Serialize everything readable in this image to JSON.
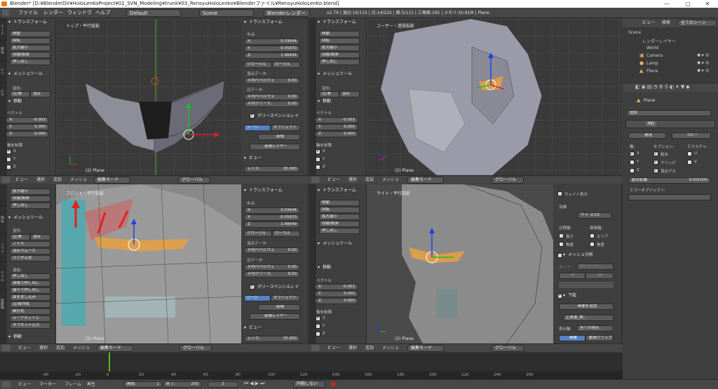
{
  "window": {
    "title": "Blender* [D:¥BlenderDir¥HoloLenKoProject¥01_SVN_Modeling¥trunk¥03_RensyuHoloLenko¥Blenderファイル¥RensyuHoloLenKo.blend]",
    "controls": [
      "—",
      "▢",
      "✕"
    ]
  },
  "infobar": {
    "menus": [
      "ファイル",
      "レンダー",
      "ウィンドウ",
      "ヘルプ"
    ],
    "screen_layout": "Default",
    "scene": "Scene",
    "render_engine": "Blenderレンダー",
    "stats": "v2.79 | 頂点:10/115 | 辺:14/225 | 面:5/111 | 三角面:195 | メモリ:30.91M | Plane"
  },
  "views": {
    "top_left": {
      "label": "トップ・平行投影",
      "object": "(2) Plane"
    },
    "top_right": {
      "label": "ユーザー・透視投影",
      "object": "(2) Plane"
    },
    "bottom_left": {
      "label": "フロント・平行投影",
      "object": "(2) Plane"
    },
    "bottom_right": {
      "label": "ライト・平行投影",
      "object": "(2) Plane"
    }
  },
  "view_header": {
    "menus": [
      "ビュー",
      "選択",
      "追加",
      "メッシュ"
    ],
    "mode": "編集モード",
    "orientation": "グローバル"
  },
  "tool_shelf": {
    "transform_title": "トランスフォーム",
    "transform_buttons": [
      "移動",
      "回転",
      "拡大縮小",
      "収縮/膨張",
      "押し出し"
    ],
    "mesh_tools_title": "メッシュツール",
    "deform_label": "変形:",
    "smooth_vertex": "辺/滑",
    "slide_vertex": "頂点",
    "noise": "ノイズ",
    "vertex_smooth": "頂点スムーズ",
    "randomize": "ランダム化",
    "add_label": "追加:",
    "extrude": "押し出し",
    "extrude_individual": "領域で押し出し",
    "extrude_along": "個々で押し出し",
    "duplicate": "面を差し込み",
    "edge_loop": "辺/面作成",
    "subdivide": "細分化",
    "loop_cut": "ループカットと",
    "offset_edge": "オフセット辺ス",
    "move_title": "移動",
    "vector_label": "ベクトル",
    "axis_constraint_label": "軸を制限",
    "vector": [
      {
        "axis": "X:",
        "value": "-0.003"
      },
      {
        "axis": "Y:",
        "value": "0.000"
      },
      {
        "axis": "Z:",
        "value": "0.000"
      }
    ],
    "axes": [
      "X",
      "Y",
      "Z"
    ]
  },
  "nprop": {
    "transform_title": "トランスフォーム",
    "median_label": "中点:",
    "median": [
      {
        "axis": "X:",
        "value": "0.03644"
      },
      {
        "axis": "Y:",
        "value": "-0.05870"
      },
      {
        "axis": "Z:",
        "value": "1.48449"
      }
    ],
    "global": "グローバル",
    "local": "ローカル",
    "vertex_data_label": "頂点データ:",
    "mean_bevel_weight": "平均ベベルウェ",
    "edge_data_label": "辺データ:",
    "mean_bevel_edge": "平均ベベルウェ",
    "mean_crease": "平均クリース:",
    "zero": "0.00",
    "gpencil_title": "グリースペンシルレイ",
    "scene": "シーン",
    "object": "オブジェクト",
    "new": "新規",
    "new_layer": "新規レイヤー",
    "view_title": "ビュー",
    "lens_label": "レンズ:",
    "lens_value": "35.000"
  },
  "outliner": {
    "menus": [
      "ビュー",
      "検索"
    ],
    "filter": "全てのシーン",
    "items": [
      {
        "name": "Scene",
        "color": "#cfcfcf"
      },
      {
        "name": "レンダーレイヤー",
        "color": "#cfcfcf"
      },
      {
        "name": "World",
        "color": "#cfcfcf"
      },
      {
        "name": "Camera",
        "color": "#e8b060"
      },
      {
        "name": "Lamp",
        "color": "#e8b060"
      },
      {
        "name": "Plane",
        "color": "#e8b060"
      }
    ]
  },
  "properties": {
    "object_name": "Plane",
    "add_modifier": "追加",
    "modifier_name": "Mir",
    "apply": "適用",
    "copy": "コピー",
    "axis_label": "軸:",
    "options_label": "オプション:",
    "texture_label": "テクスチャ:",
    "axes": [
      "X",
      "Y",
      "Z"
    ],
    "options": [
      "結合",
      "クリッピ",
      "頂点グル"
    ],
    "uv": [
      "U",
      "V"
    ],
    "merge_limit_label": "結合距離:",
    "merge_limit": "0.001000",
    "mirror_object_label": "ミラーオブジェクト:",
    "weight_display": "ウェイト表示",
    "normals_label": "法線",
    "size_label": "サイ: 0.10",
    "edge_info_label": "辺情報:",
    "face_info_label": "面情報:",
    "length": "長さ",
    "area": "エリア",
    "angle": "角度",
    "angle2": "角度",
    "mesh_analysis": "メッシュ分析",
    "type_label": "タイプ",
    "overhang": "オーバーハ...",
    "range_0": "0°",
    "range_45": "45°",
    "background_title": "下絵",
    "add_image": "画像を追加",
    "front_image": "正面進_横...",
    "axis_label2": "表示軸",
    "all_views": "全ての視点",
    "image": "画像",
    "movie_clip": "動画クリップ"
  },
  "timeline": {
    "menus": [
      "ビュー",
      "マーカー",
      "フレーム",
      "再生"
    ],
    "start_label": "開始:",
    "start": "1",
    "end_label": "終了:",
    "end": "250",
    "current": "2",
    "sync": "同期しない",
    "ticks": [
      "-40",
      "-20",
      "0",
      "20",
      "40",
      "60",
      "80",
      "100",
      "120",
      "140",
      "160",
      "180",
      "200",
      "220",
      "240",
      "260"
    ]
  },
  "colors": {
    "accent_blue": "#5680c2",
    "selection_orange": "#e8a040",
    "mesh_gray": "#9a9aa8",
    "red_arrow": "#e02020"
  }
}
